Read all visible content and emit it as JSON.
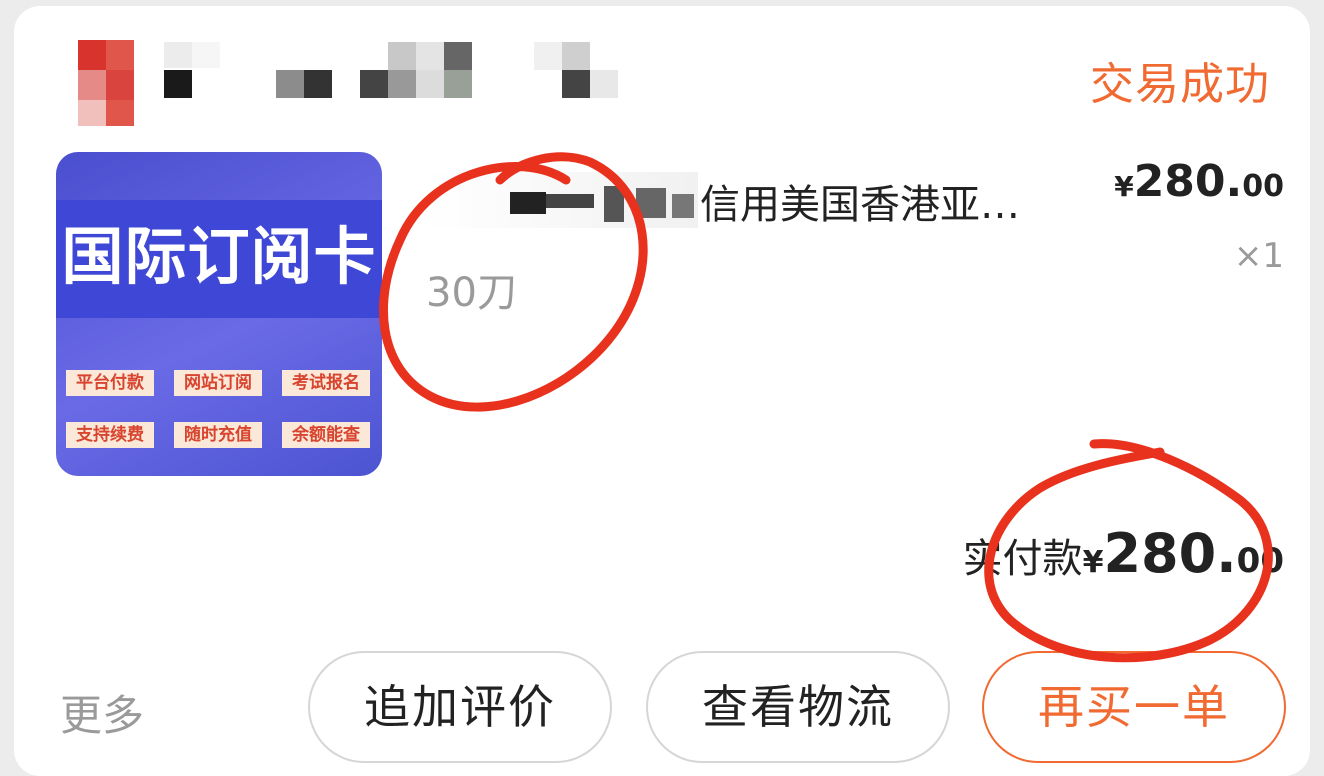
{
  "order": {
    "status": "交易成功",
    "product": {
      "thumbnail": {
        "title": "国际订阅卡",
        "tags": [
          "平台付款",
          "网站订阅",
          "考试报名",
          "支持续费",
          "随时充值",
          "余额能查"
        ]
      },
      "title": "信用美国香港亚…",
      "spec": "30刀",
      "price": {
        "symbol": "¥",
        "integer": "280.",
        "decimal": "00"
      },
      "quantity": "×1"
    },
    "payment": {
      "label": "实付款",
      "symbol": "¥",
      "integer": "280.",
      "decimal": "00"
    },
    "actions": {
      "more": "更多",
      "review": "追加评价",
      "logistics": "查看物流",
      "rebuy": "再买一单"
    }
  },
  "colors": {
    "accent": "#f06a32",
    "annotation": "#e8321e",
    "thumbnail_bg": "#4a4fcf"
  }
}
